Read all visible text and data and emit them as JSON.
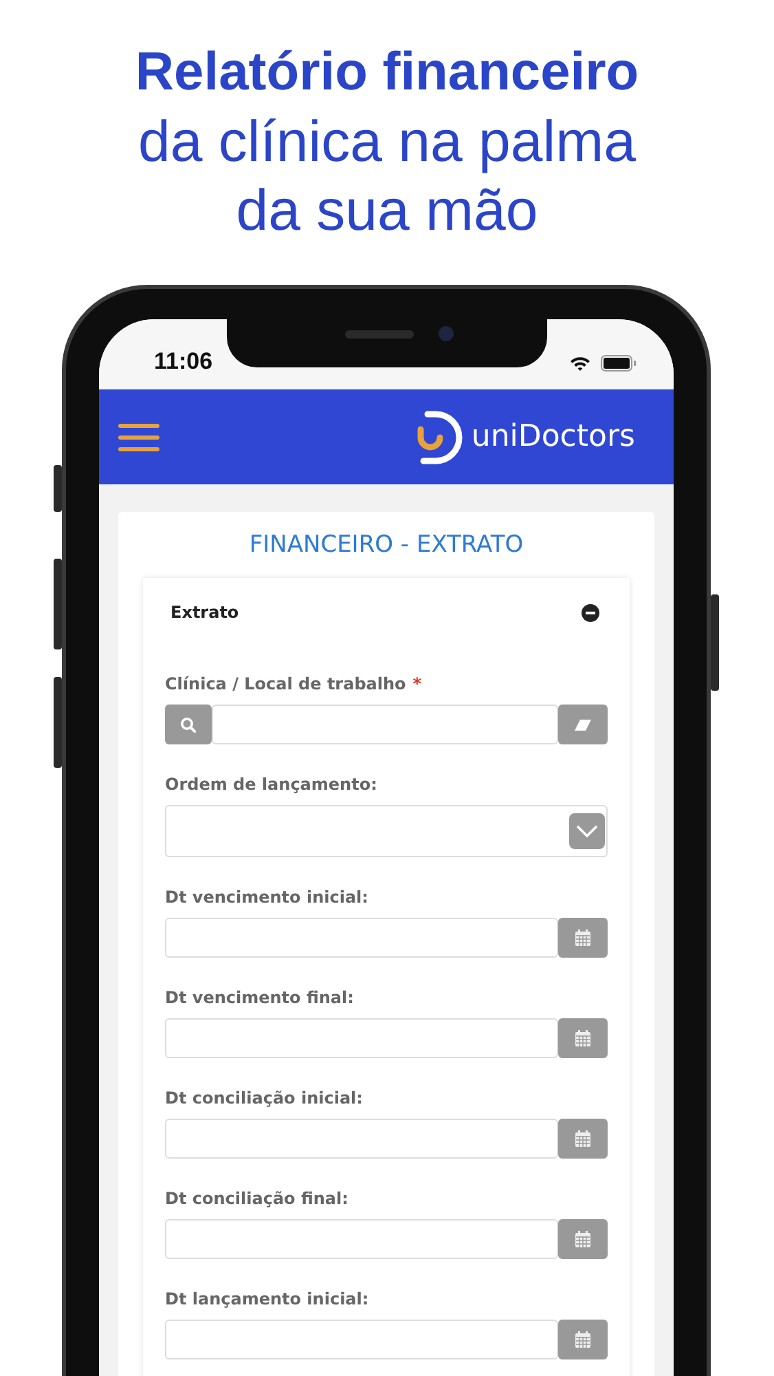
{
  "headline": {
    "lines": [
      {
        "text": "Relatório financeiro",
        "bold": true
      },
      {
        "text": "da clínica na palma",
        "bold": false
      },
      {
        "text": "da sua mão",
        "bold": false
      }
    ]
  },
  "status_bar": {
    "time": "11:06"
  },
  "app_bar": {
    "brand": "uniDoctors"
  },
  "page": {
    "title": "FINANCEIRO - EXTRATO",
    "panel": {
      "title": "Extrato",
      "expanded": true,
      "fields": [
        {
          "kind": "search",
          "label": "Clínica / Local de trabalho",
          "required_mark": "*"
        },
        {
          "kind": "select",
          "label": "Ordem de lançamento:"
        },
        {
          "kind": "date",
          "label": "Dt vencimento inicial:"
        },
        {
          "kind": "date",
          "label": "Dt vencimento final:"
        },
        {
          "kind": "date",
          "label": "Dt conciliação inicial:"
        },
        {
          "kind": "date",
          "label": "Dt conciliação final:"
        },
        {
          "kind": "date",
          "label": "Dt lançamento inicial:"
        }
      ]
    }
  }
}
